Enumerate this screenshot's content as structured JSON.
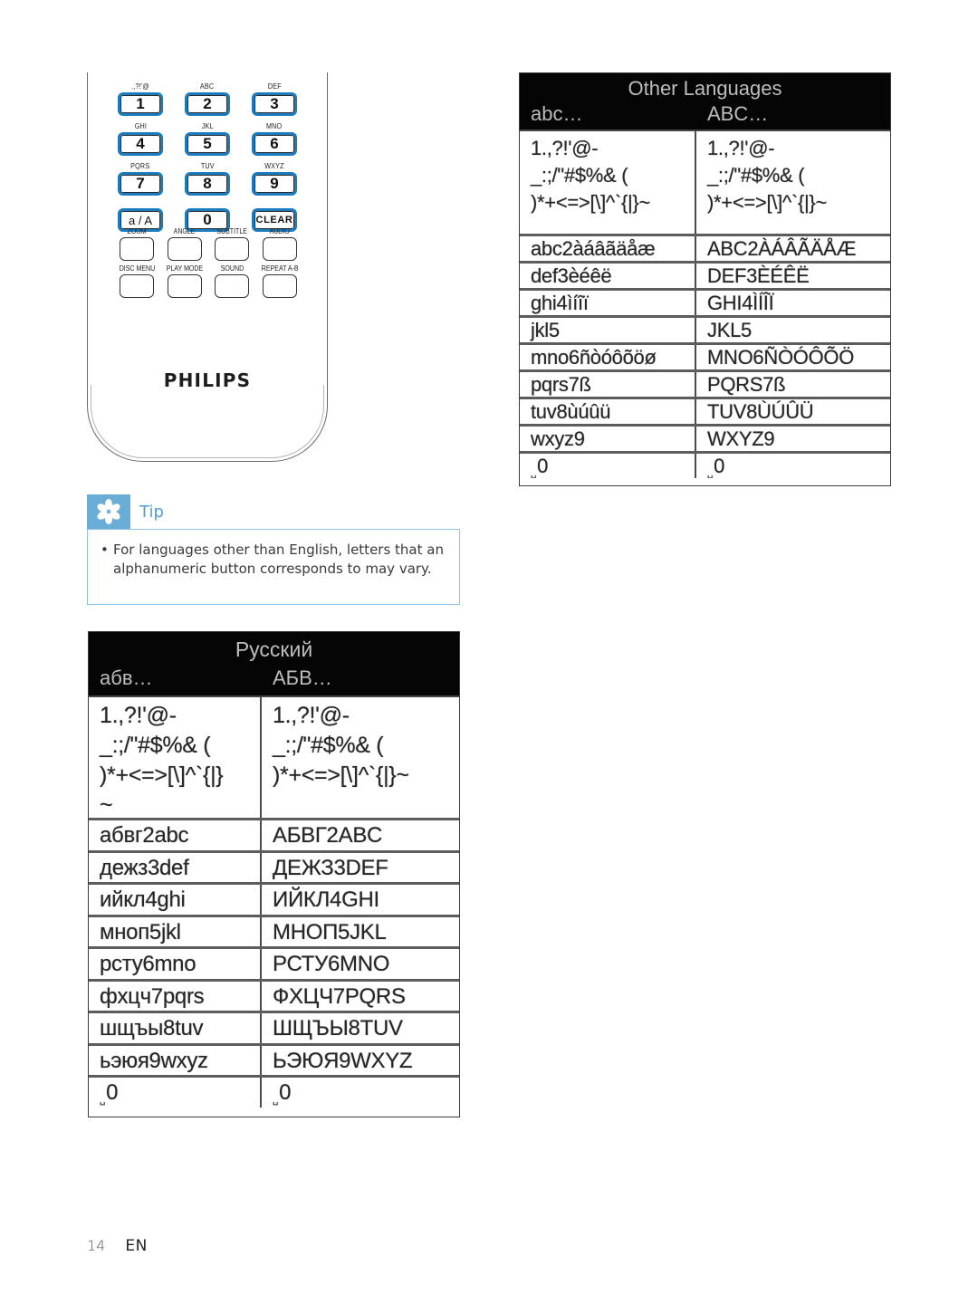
{
  "remote": {
    "brand": "PHILIPS",
    "keypad": [
      [
        {
          "sub": ".,?!'@",
          "label": "1"
        },
        {
          "sub": "ABC",
          "label": "2"
        },
        {
          "sub": "DEF",
          "label": "3"
        }
      ],
      [
        {
          "sub": "GHI",
          "label": "4"
        },
        {
          "sub": "JKL",
          "label": "5"
        },
        {
          "sub": "MNO",
          "label": "6"
        }
      ],
      [
        {
          "sub": "PQRS",
          "label": "7"
        },
        {
          "sub": "TUV",
          "label": "8"
        },
        {
          "sub": "WXYZ",
          "label": "9"
        }
      ],
      [
        {
          "sub": "",
          "label": "a / A"
        },
        {
          "sub": "",
          "label": "0"
        },
        {
          "sub": "",
          "label": "CLEAR"
        }
      ]
    ],
    "function_keys": [
      [
        "ZOOM",
        "ANGLE",
        "SUBTITLE",
        "AUDIO"
      ],
      [
        "DISC MENU",
        "PLAY MODE",
        "SOUND",
        "REPEAT A-B"
      ]
    ],
    "key_accent_color": "#1a7bbf"
  },
  "tip": {
    "title": "Tip",
    "icon": "asterisk-icon",
    "accent_color": "#6aaed8",
    "items": [
      "For languages other than English, letters that an alphanumeric button corresponds to may vary."
    ]
  },
  "tables": {
    "other": {
      "title": "Other Languages",
      "col_lower": "abc…",
      "col_upper": "ABC…",
      "symbols_lower": "1.,?!'@-\n_:;/\"#$%& (\n)*+<=>[\\]^`{|}~",
      "symbols_upper": "1.,?!'@-\n_:;/\"#$%& (\n)*+<=>[\\]^`{|}~",
      "rows": [
        [
          "abc2àáâãäåæ",
          "ABC2ÀÁÂÃÄÅÆ"
        ],
        [
          "def3èéêë",
          "DEF3ÈÉÊË"
        ],
        [
          "ghi4ìíîï",
          "GHI4ÌÍÎÏ"
        ],
        [
          "jkl5",
          "JKL5"
        ],
        [
          "mno6ñòóôõöø",
          "MNO6ÑÒÓÔÕÖ"
        ],
        [
          "pqrs7ß",
          "PQRS7ß"
        ],
        [
          "tuv8ùúûü",
          "TUV8ÙÚÛÜ"
        ],
        [
          "wxyz9",
          "WXYZ9"
        ],
        [
          "␣0",
          "␣0"
        ]
      ]
    },
    "russian": {
      "title": "Русский",
      "col_lower": "абв…",
      "col_upper": "АБВ…",
      "symbols_lower": "1.,?!'@-\n_:;/\"#$%& (\n)*+<=>[\\]^`{|}\n~",
      "symbols_upper": "1.,?!'@-\n_:;/\"#$%& (\n)*+<=>[\\]^`{|}~",
      "rows": [
        [
          "абвг2abc",
          "АБВГ2ABC"
        ],
        [
          "дежз3def",
          "ДЕЖЗ3DEF"
        ],
        [
          "ийкл4ghi",
          "ИЙКЛ4GHI"
        ],
        [
          "мноп5jkl",
          "МНОП5JKL"
        ],
        [
          "рсту6mno",
          "РСТУ6MNO"
        ],
        [
          "фхцч7pqrs",
          "ФХЦЧ7PQRS"
        ],
        [
          "шщъы8tuv",
          "ШЩЪЫ8TUV"
        ],
        [
          "ьэюя9wxyz",
          "ЬЭЮЯ9WXYZ"
        ],
        [
          "␣0",
          "␣0"
        ]
      ]
    }
  },
  "footer": {
    "page_number": "14",
    "language": "EN"
  }
}
